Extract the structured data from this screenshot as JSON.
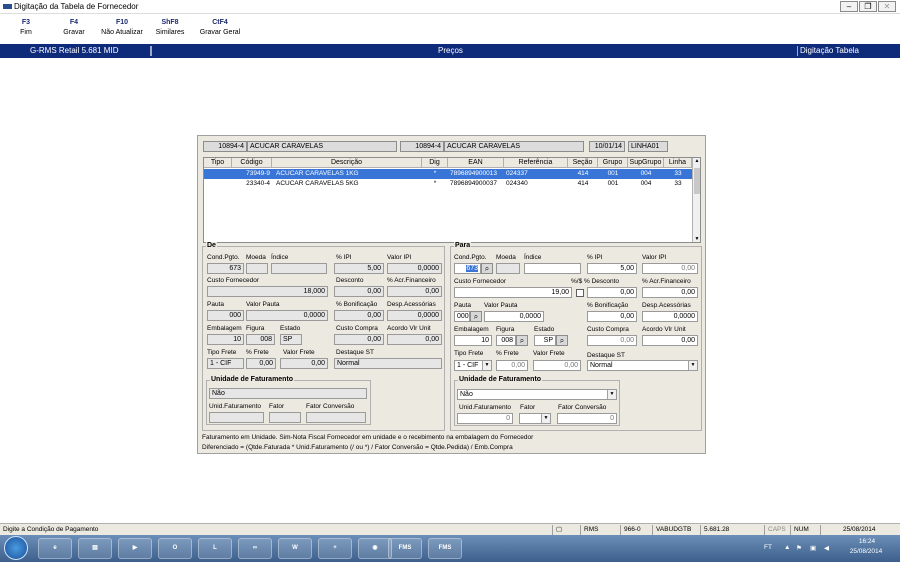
{
  "window": {
    "title": "Digitação da Tabela de Fornecedor"
  },
  "toolbar": [
    {
      "key": "F3",
      "label": "Fim"
    },
    {
      "key": "F4",
      "label": "Gravar"
    },
    {
      "key": "F10",
      "label": "Não Atualizar"
    },
    {
      "key": "ShF8",
      "label": "Similares"
    },
    {
      "key": "CtF4",
      "label": "Gravar Geral"
    }
  ],
  "header": {
    "left": "G-RMS Retail 5.681 MID",
    "center": "Preços",
    "right": "Digitação Tabela"
  },
  "top_info": {
    "code1": "10894-4",
    "name1": "ACUCAR CARAVELAS",
    "code2": "10894-4",
    "name2": "ACUCAR CARAVELAS",
    "date": "10/01/14",
    "line": "LINHA01"
  },
  "grid": {
    "columns": [
      "Tipo",
      "Código",
      "Descrição",
      "Dig",
      "EAN",
      "Referência",
      "Seção",
      "Grupo",
      "SupGrupo",
      "Linha"
    ],
    "rows": [
      {
        "tipo": "",
        "codigo": "73949-9",
        "descricao": "ACUCAR CARAVELAS 1KG",
        "dig": "*",
        "ean": "7896894900013",
        "referencia": "024337",
        "secao": "414",
        "grupo": "001",
        "supgrupo": "004",
        "linha": "33"
      },
      {
        "tipo": "",
        "codigo": "23340-4",
        "descricao": "ACUCAR CARAVELAS 5KG",
        "dig": "*",
        "ean": "7896894900037",
        "referencia": "024340",
        "secao": "414",
        "grupo": "001",
        "supgrupo": "004",
        "linha": "33"
      }
    ]
  },
  "labels": {
    "de": "De",
    "para": "Para",
    "cond_pgto": "Cond.Pgto.",
    "moeda": "Moeda",
    "indice": "Índice",
    "pct_ipi": "% IPI",
    "valor_ipi": "Valor IPI",
    "custo_fornecedor": "Custo Fornecedor",
    "desconto": "Desconto",
    "pct_s_desconto": "%/$ % Desconto",
    "pct_acr_financeiro": "% Acr.Financeiro",
    "pauta": "Pauta",
    "valor_pauta": "Valor Pauta",
    "pct_bonificacao": "% Bonificação",
    "desp_acessorias": "Desp.Acessórias",
    "embalagem": "Embalagem",
    "figura": "Figura",
    "estado": "Estado",
    "custo_compra": "Custo Compra",
    "acordo_vlr_unit": "Acordo Vlr Unit",
    "tipo_frete": "Tipo Frete",
    "pct_frete": "% Frete",
    "valor_frete": "Valor Frete",
    "destaque_st": "Destaque ST",
    "unidade_faturamento": "Unidade de Faturamento",
    "unid_faturamento": "Unid.Faturamento",
    "fator": "Fator",
    "fator_conversao": "Fator Conversão"
  },
  "de": {
    "cond_pgto": "673",
    "moeda": "",
    "indice": "",
    "pct_ipi": "5,00",
    "valor_ipi": "0,0000",
    "custo_fornecedor": "18,000",
    "desconto": "0,00",
    "acr_financeiro": "0,00",
    "pauta": "000",
    "valor_pauta": "0,0000",
    "bonificacao": "0,00",
    "desp_acessorias": "0,0000",
    "embalagem": "10",
    "figura": "008",
    "estado": "SP",
    "custo_compra": "0,00",
    "acordo_vlr_unit": "0,00",
    "tipo_frete": "1 - CIF",
    "pct_frete": "0,00",
    "valor_frete": "0,00",
    "destaque_st": "Normal",
    "unidade": "Não",
    "unid_faturamento": "",
    "fator": "",
    "fator_conversao": ""
  },
  "para": {
    "cond_pgto": "673",
    "moeda": "",
    "indice": "",
    "pct_ipi": "5,00",
    "valor_ipi": "0,00",
    "custo_fornecedor": "19,00",
    "desconto": "0,00",
    "acr_financeiro": "0,00",
    "pauta": "000",
    "valor_pauta": "0,0000",
    "bonificacao": "0,00",
    "desp_acessorias": "0,0000",
    "embalagem": "10",
    "figura": "008",
    "estado": "SP",
    "custo_compra": "0,00",
    "acordo_vlr_unit": "0,00",
    "tipo_frete": "1 - CIF",
    "pct_frete": "0,00",
    "valor_frete": "0,00",
    "destaque_st": "Normal",
    "unidade": "Não",
    "unid_faturamento": "0",
    "fator": "",
    "fator_conversao": "0"
  },
  "notes": {
    "line1": "Faturamento em Unidade. Sim-Nota Fiscal Fornecedor em unidade e o recebimento na embalagem do Fornecedor",
    "line2": "Diferenciado = (Qtde.Faturada * Unid.Faturamento (/ ou *) / Fator Conversão = Qtde.Pedida) / Emb.Compra"
  },
  "status": {
    "message": "Digite a Condição de Pagamento",
    "system": "RMS",
    "code": "966-0",
    "user": "VABUDGTB",
    "version": "5.681.28",
    "caps": "CAPS",
    "num": "NUM",
    "date": "25/08/2014"
  },
  "taskbar": {
    "items": [
      "FMS",
      "FMS"
    ],
    "lang": "FT",
    "time": "16:24",
    "date": "25/08/2014"
  }
}
